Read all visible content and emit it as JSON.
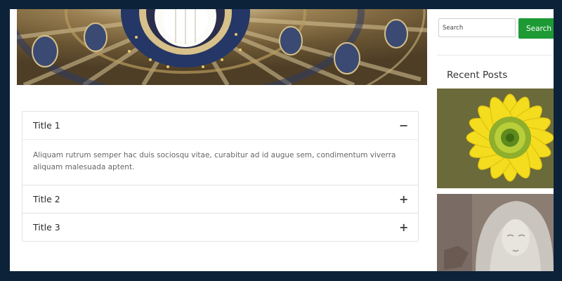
{
  "accordion": {
    "items": [
      {
        "title": "Title 1",
        "expanded": true,
        "body": "Aliquam rutrum semper hac duis sociosqu vitae, curabitur ad id augue sem, condimentum viverra aliquam malesuada aptent.",
        "toggle": "−"
      },
      {
        "title": "Title 2",
        "expanded": false,
        "toggle": "+"
      },
      {
        "title": "Title 3",
        "expanded": false,
        "toggle": "+"
      }
    ]
  },
  "sidebar": {
    "search": {
      "placeholder": "Search",
      "button_label": "Search"
    },
    "recent_posts_heading": "Recent Posts",
    "posts": [
      {
        "thumbnail": "yellow-flower"
      },
      {
        "thumbnail": "pieta-statue"
      }
    ]
  },
  "hero": {
    "image": "basilica-dome"
  },
  "colors": {
    "frame_bg": "#0c2238",
    "accent": "#1e9a35"
  }
}
